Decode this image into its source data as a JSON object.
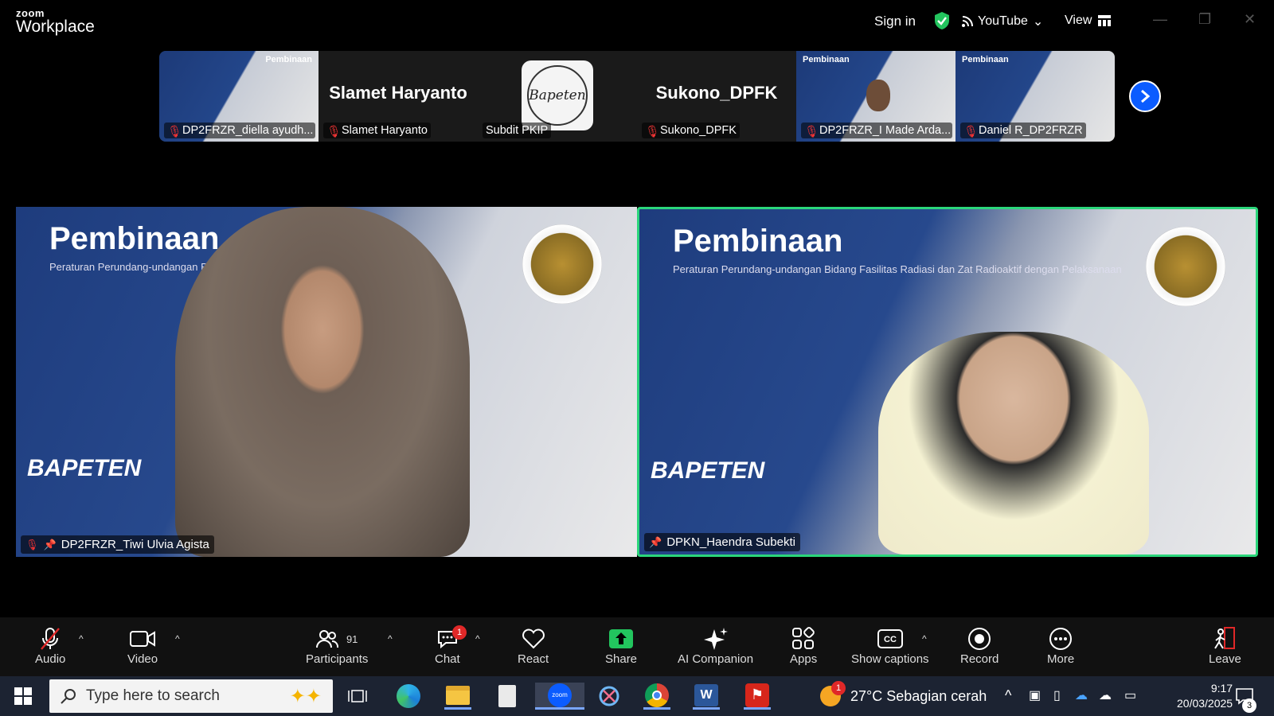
{
  "app": {
    "logo_line1": "zoom",
    "logo_line2": "Workplace"
  },
  "header": {
    "sign_in": "Sign in",
    "stream_label": "YouTube",
    "view_label": "View"
  },
  "gallery": {
    "thumbs": [
      {
        "name": "DP2FRZR_diella ayudh...",
        "banner": "Pembinaan"
      },
      {
        "name": "Slamet Haryanto",
        "big": "Slamet Haryanto"
      },
      {
        "name": "Subdit PKIP",
        "logo_text": "Bapeten"
      },
      {
        "name": "Sukono_DPFK",
        "big": "Sukono_DPFK"
      },
      {
        "name": "DP2FRZR_I Made Arda...",
        "banner": "Pembinaan"
      },
      {
        "name": "Daniel R_DP2FRZR",
        "banner": "Pembinaan"
      }
    ]
  },
  "tiles": [
    {
      "name": "DP2FRZR_Tiwi Ulvia Agista",
      "title": "Pembinaan",
      "subtitle": "Peraturan Perundang-undangan Bidang Fasilitas R",
      "org": "BAPETEN"
    },
    {
      "name": "DPKN_Haendra Subekti",
      "title": "Pembinaan",
      "subtitle": "Peraturan Perundang-undangan Bidang Fasilitas Radiasi dan Zat Radioaktif dengan Pelaksanaan",
      "org": "BAPETEN"
    }
  ],
  "toolbar": {
    "audio": "Audio",
    "video": "Video",
    "participants": "Participants",
    "participants_count": "91",
    "chat": "Chat",
    "chat_badge": "1",
    "react": "React",
    "share": "Share",
    "ai": "AI Companion",
    "apps": "Apps",
    "captions": "Show captions",
    "record": "Record",
    "more": "More",
    "leave": "Leave"
  },
  "taskbar": {
    "search_placeholder": "Type here to search",
    "weather": "27°C  Sebagian cerah",
    "time": "9:17",
    "date": "20/03/2025",
    "notif_count": "3",
    "weather_badge": "1"
  }
}
